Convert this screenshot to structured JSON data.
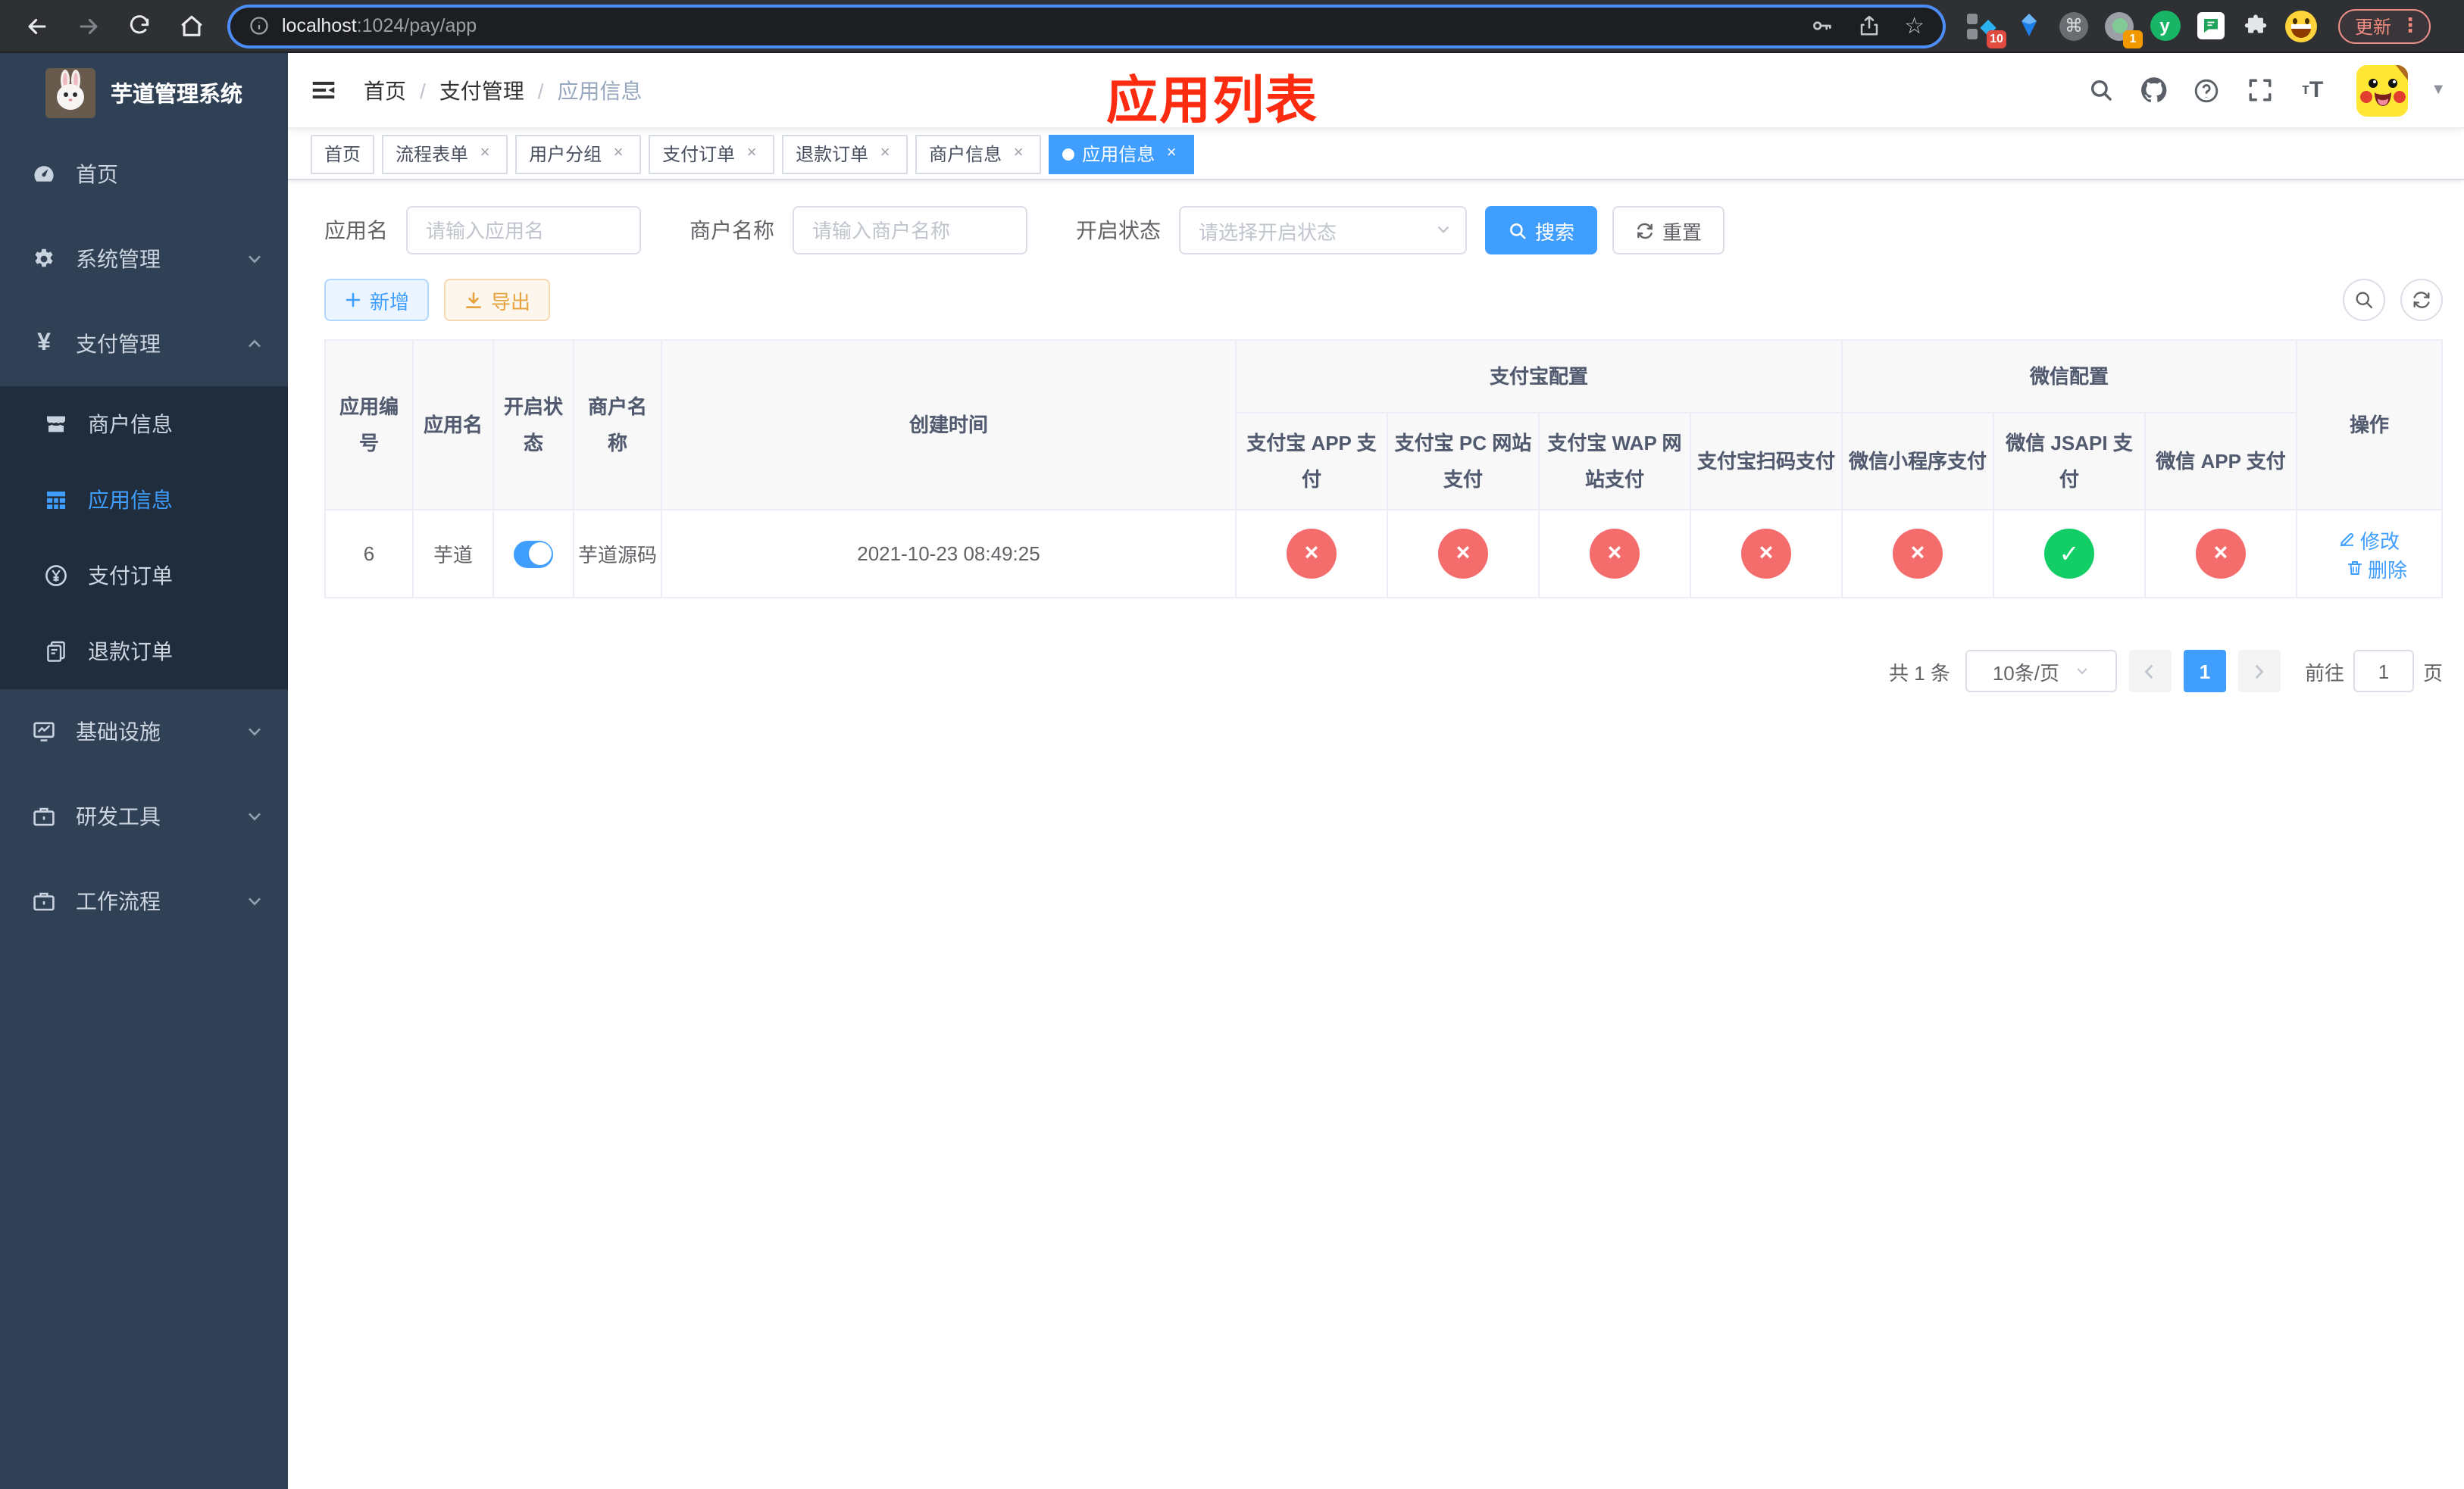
{
  "browser": {
    "url_host": "localhost",
    "url_rest": ":1024/pay/app",
    "update_label": "更新",
    "ext_badge_1": "10",
    "ext_badge_2": "1",
    "ext_cmd_glyph": "⌘",
    "ext_y_glyph": "y"
  },
  "sidebar": {
    "title": "芋道管理系统",
    "items": [
      {
        "label": "首页",
        "icon": "gauge",
        "level": "root",
        "chevron": "",
        "active": false
      },
      {
        "label": "系统管理",
        "icon": "gear",
        "level": "root",
        "chevron": "down",
        "active": false
      },
      {
        "label": "支付管理",
        "icon": "yen",
        "level": "root",
        "chevron": "up",
        "active": false
      },
      {
        "label": "商户信息",
        "icon": "shop",
        "level": "sub",
        "chevron": "",
        "active": false
      },
      {
        "label": "应用信息",
        "icon": "grid",
        "level": "sub",
        "chevron": "",
        "active": true
      },
      {
        "label": "支付订单",
        "icon": "yen-circle",
        "level": "sub",
        "chevron": "",
        "active": false
      },
      {
        "label": "退款订单",
        "icon": "doc",
        "level": "sub",
        "chevron": "",
        "active": false
      },
      {
        "label": "基础设施",
        "icon": "monitor",
        "level": "root",
        "chevron": "down",
        "active": false
      },
      {
        "label": "研发工具",
        "icon": "briefcase",
        "level": "root",
        "chevron": "down",
        "active": false
      },
      {
        "label": "工作流程",
        "icon": "briefcase",
        "level": "root",
        "chevron": "down",
        "active": false
      }
    ]
  },
  "navbar": {
    "breadcrumb": [
      "首页",
      "支付管理",
      "应用信息"
    ],
    "annotation": "应用列表"
  },
  "tabs": [
    {
      "label": "首页",
      "closable": false,
      "active": false
    },
    {
      "label": "流程表单",
      "closable": true,
      "active": false
    },
    {
      "label": "用户分组",
      "closable": true,
      "active": false
    },
    {
      "label": "支付订单",
      "closable": true,
      "active": false
    },
    {
      "label": "退款订单",
      "closable": true,
      "active": false
    },
    {
      "label": "商户信息",
      "closable": true,
      "active": false
    },
    {
      "label": "应用信息",
      "closable": true,
      "active": true
    }
  ],
  "filter": {
    "app_name_label": "应用名",
    "app_name_placeholder": "请输入应用名",
    "merchant_label": "商户名称",
    "merchant_placeholder": "请输入商户名称",
    "status_label": "开启状态",
    "status_placeholder": "请选择开启状态",
    "search_label": "搜索",
    "reset_label": "重置"
  },
  "actions": {
    "add_label": "新增",
    "export_label": "导出"
  },
  "table": {
    "plain_columns": [
      "应用编号",
      "应用名",
      "开启状态",
      "商户名称",
      "创建时间"
    ],
    "group_alipay": "支付宝配置",
    "group_wechat": "微信配置",
    "sub_columns": [
      "支付宝 APP 支付",
      "支付宝 PC 网站支付",
      "支付宝 WAP 网站支付",
      "支付宝扫码支付",
      "微信小程序支付",
      "微信 JSAPI 支付",
      "微信 APP 支付"
    ],
    "op_column": "操作",
    "row": {
      "id": "6",
      "name": "芋道",
      "enabled": true,
      "merchant": "芋道源码",
      "created": "2021-10-23 08:49:25",
      "configs": [
        false,
        false,
        false,
        false,
        false,
        true,
        false
      ],
      "edit_label": "修改",
      "delete_label": "删除"
    }
  },
  "pagination": {
    "total_text": "共 1 条",
    "page_size": "10条/页",
    "page": "1",
    "goto_label": "前往",
    "goto_value": "1",
    "goto_suffix": "页"
  },
  "colors": {
    "primary": "#409eff",
    "danger": "#f56c6c",
    "success": "#13ce66",
    "annotation": "#fd2b0f",
    "sidebar": "#304156",
    "submenu": "#1f2d3d"
  }
}
